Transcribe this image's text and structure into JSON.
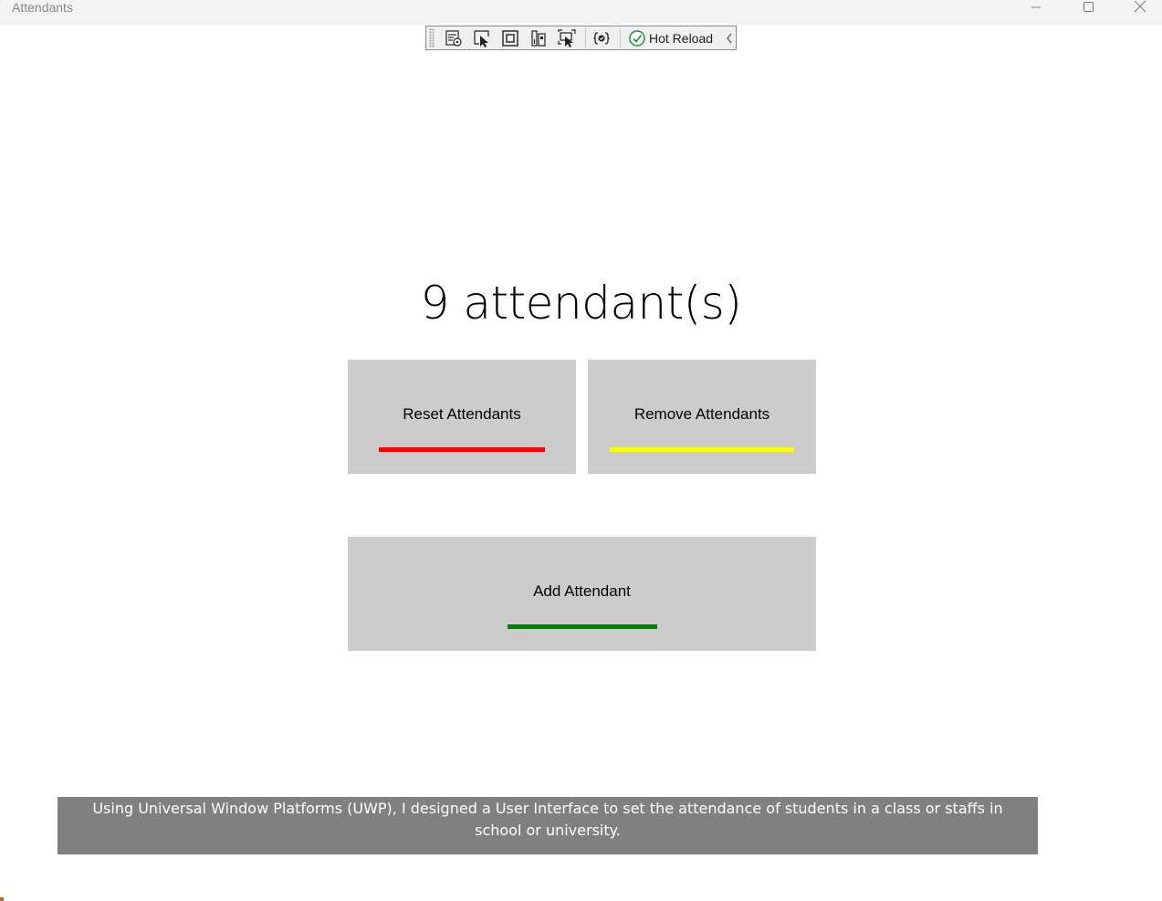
{
  "window": {
    "title": "Attendants"
  },
  "devbar": {
    "icons": [
      "live-visual-tree-icon",
      "select-element-icon",
      "display-layout-adorners-icon",
      "track-focus-icon",
      "preview-selection-icon",
      "binding-failures-icon"
    ],
    "hot_reload_label": "Hot Reload"
  },
  "main": {
    "count_text": "9 attendant(s)",
    "buttons": {
      "reset": {
        "label": "Reset Attendants",
        "accent": "#ff0000"
      },
      "remove": {
        "label": "Remove Attendants",
        "accent": "#ffff00"
      },
      "add": {
        "label": "Add Attendant",
        "accent": "#008000"
      }
    }
  },
  "caption": {
    "text": "Using Universal Window Platforms (UWP), I designed a User Interface to set the attendance of students in a class or staffs in school or university."
  },
  "colors": {
    "button_background": "#cccccc",
    "caption_background": "#808080"
  }
}
